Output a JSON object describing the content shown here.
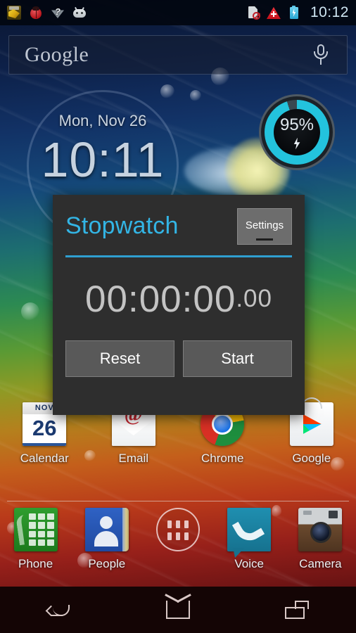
{
  "statusbar": {
    "left_icons": [
      {
        "name": "honey-jar-icon",
        "label": "Honey jar notification"
      },
      {
        "name": "ladybug-icon",
        "label": "Ladybug notification"
      },
      {
        "name": "wifi-question-icon",
        "label": "Wi-Fi unknown",
        "glyph": "?"
      },
      {
        "name": "android-head-icon",
        "label": "Android notification"
      }
    ],
    "right_icons": [
      {
        "name": "sim-missing-icon",
        "label": "No SIM card"
      },
      {
        "name": "alert-triangle-icon",
        "label": "Alert"
      },
      {
        "name": "battery-charging-icon",
        "label": "Battery charging"
      }
    ],
    "time": "10:12"
  },
  "search": {
    "logo_text": "Google",
    "mic_name": "microphone-icon"
  },
  "clock_widget": {
    "date": "Mon, Nov 26",
    "time": "10:11"
  },
  "battery_widget": {
    "percent_label": "95%",
    "percent_value": 95,
    "charging": true,
    "ring_color": "#23c3dd"
  },
  "dialog": {
    "title": "Stopwatch",
    "title_color": "#33b5e5",
    "settings_label": "Settings",
    "time_main": "00:00:00",
    "time_fraction": ".00",
    "buttons": [
      {
        "label": "Reset",
        "name": "reset-button"
      },
      {
        "label": "Start",
        "name": "start-button"
      }
    ]
  },
  "apps_row1": [
    {
      "label": "Calendar",
      "icon": "calendar-icon",
      "month": "NOV",
      "day": "26"
    },
    {
      "label": "Email",
      "icon": "email-icon",
      "glyph": "@"
    },
    {
      "label": "Chrome",
      "icon": "chrome-icon"
    },
    {
      "label": "Google",
      "icon": "play-store-icon"
    }
  ],
  "dock": [
    {
      "label": "Phone",
      "icon": "phone-icon"
    },
    {
      "label": "People",
      "icon": "people-icon"
    },
    {
      "label": "",
      "icon": "app-drawer-icon"
    },
    {
      "label": "Voice",
      "icon": "voice-icon"
    },
    {
      "label": "Camera",
      "icon": "camera-icon"
    }
  ],
  "navbar": [
    {
      "name": "back-button",
      "icon": "back-arrow-icon"
    },
    {
      "name": "home-button",
      "icon": "home-icon"
    },
    {
      "name": "recents-button",
      "icon": "recents-icon"
    }
  ]
}
